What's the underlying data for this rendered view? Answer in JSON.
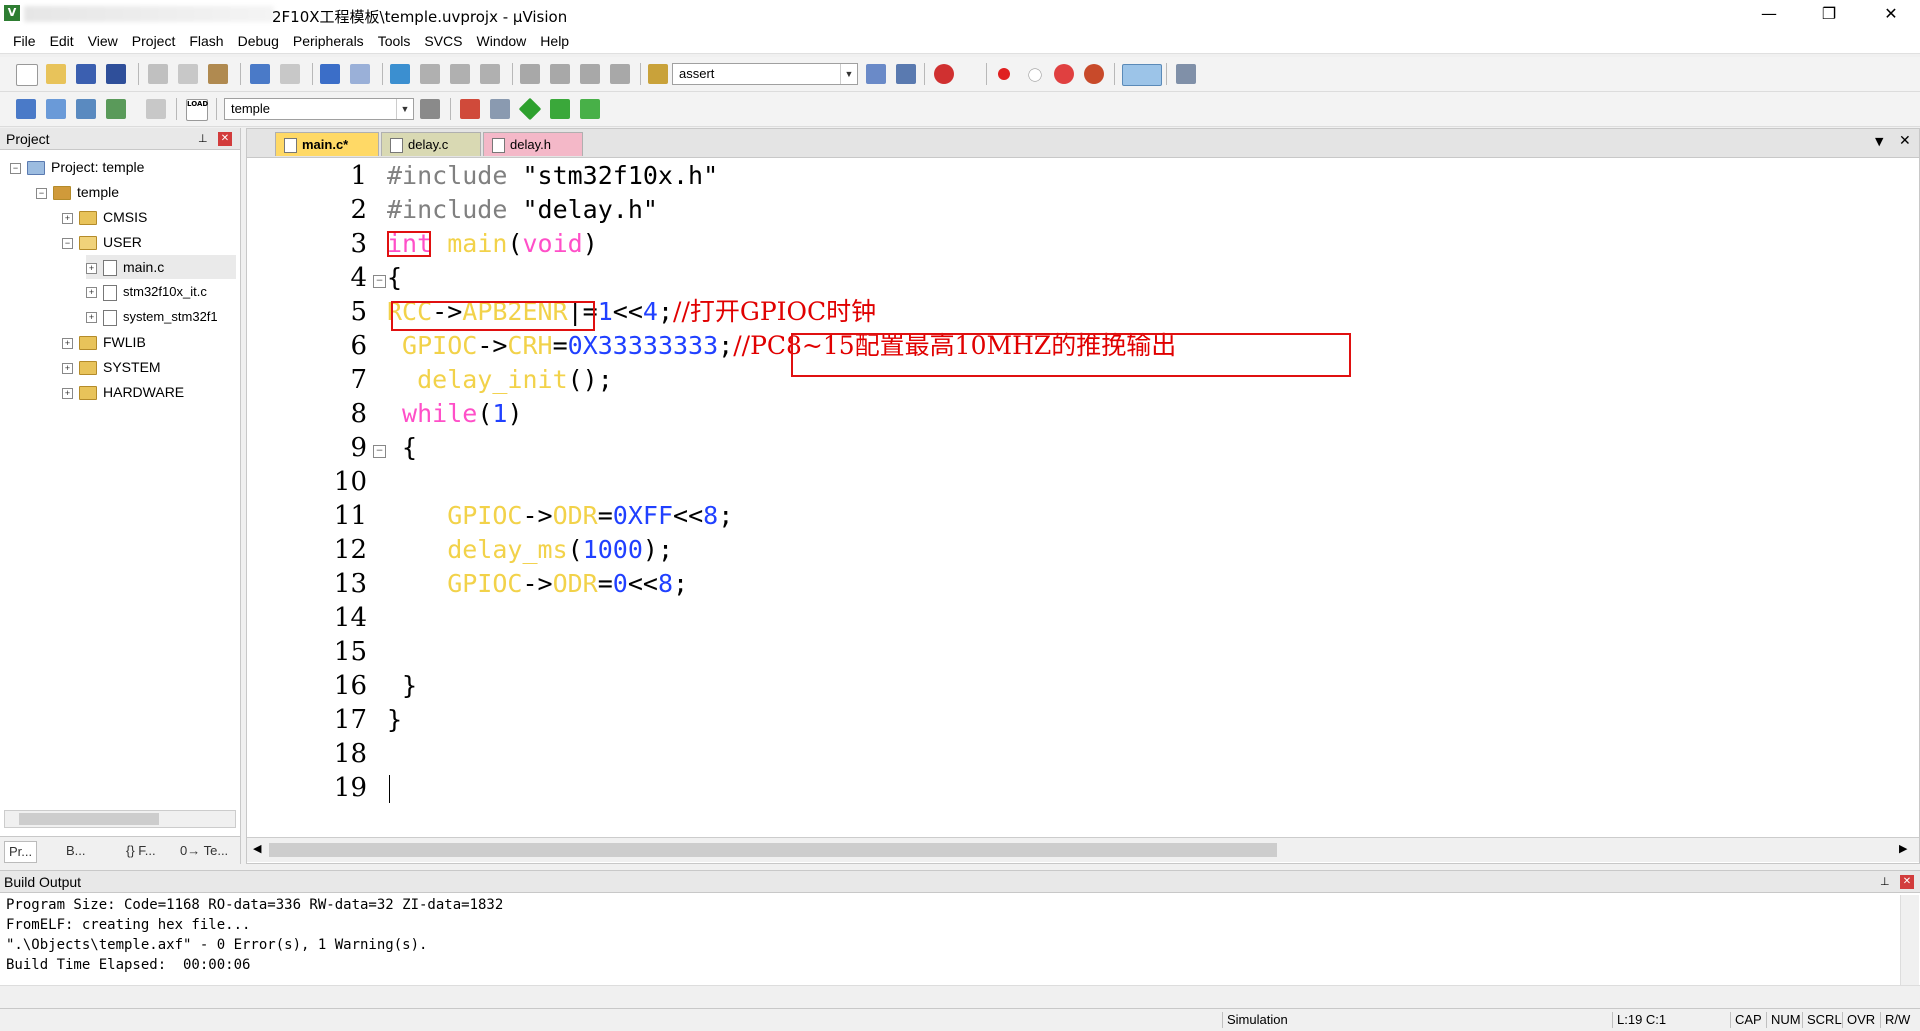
{
  "window": {
    "app_icon": "V",
    "title": "2F10X工程模板\\temple.uvprojx - µVision",
    "minimize": "—",
    "maximize": "❐",
    "close": "✕"
  },
  "menu": [
    "File",
    "Edit",
    "View",
    "Project",
    "Flash",
    "Debug",
    "Peripherals",
    "Tools",
    "SVCS",
    "Window",
    "Help"
  ],
  "toolbar1": {
    "find_combo": "assert"
  },
  "toolbar2": {
    "target_combo": "temple",
    "load_label": "LOAD"
  },
  "project_panel": {
    "title": "Project",
    "pin": "📌",
    "close": "✕",
    "tree": [
      {
        "label": "Project: temple"
      },
      {
        "label": "temple"
      },
      {
        "label": "CMSIS"
      },
      {
        "label": "USER"
      },
      {
        "label": "main.c"
      },
      {
        "label": "stm32f10x_it.c"
      },
      {
        "label": "system_stm32f1"
      },
      {
        "label": "FWLIB"
      },
      {
        "label": "SYSTEM"
      },
      {
        "label": "HARDWARE"
      }
    ],
    "tabs": [
      "Pr...",
      "B...",
      "{} F...",
      "0→ Te..."
    ]
  },
  "editor": {
    "tabs": [
      {
        "label": "main.c*",
        "active": true,
        "color": "#ffd966"
      },
      {
        "label": "delay.c",
        "active": false,
        "color": "#d9d9b3"
      },
      {
        "label": "delay.h",
        "active": false,
        "color": "#f4b8c8"
      }
    ],
    "line_numbers": [
      "1",
      "2",
      "3",
      "4",
      "5",
      "6",
      "7",
      "8",
      "9",
      "10",
      "11",
      "12",
      "13",
      "14",
      "15",
      "16",
      "17",
      "18",
      "19"
    ],
    "lines": {
      "l1_a": "#include ",
      "l1_b": "\"stm32f10x.h\"",
      "l2_a": "#include ",
      "l2_b": "\"delay.h\"",
      "l3_kw": "int",
      "l3_sp": " ",
      "l3_fn": "main",
      "l3_p1": "(",
      "l3_void": "void",
      "l3_p2": ")",
      "l4": "{",
      "l5_a": "RCC",
      "l5_b": "->",
      "l5_c": "APB2ENR",
      "l5_d": "|=",
      "l5_e": "1",
      "l5_f": "<<",
      "l5_g": "4",
      "l5_h": ";",
      "l5_cm": "//打开GPIOC时钟",
      "l6_a": " GPIOC",
      "l6_b": "->",
      "l6_c": "CRH",
      "l6_d": "=",
      "l6_e": "0X33333333",
      "l6_f": ";",
      "l6_cm": "//PC8~15配置最高10MHZ的推挽输出",
      "l7_a": "  delay_init",
      "l7_b": "();",
      "l8_a": " while",
      "l8_b": "(",
      "l8_c": "1",
      "l8_d": ")",
      "l9": " {",
      "l11_a": "    GPIOC",
      "l11_b": "->",
      "l11_c": "ODR",
      "l11_d": "=",
      "l11_e": "0XFF",
      "l11_f": "<<",
      "l11_g": "8",
      "l11_h": ";",
      "l12_a": "    delay_ms",
      "l12_b": "(",
      "l12_c": "1000",
      "l12_d": ");",
      "l13_a": "    GPIOC",
      "l13_b": "->",
      "l13_c": "ODR",
      "l13_d": "=",
      "l13_e": "0",
      "l13_f": "<<",
      "l13_g": "8",
      "l13_h": ";",
      "l16": " }",
      "l17": "}"
    }
  },
  "build_output": {
    "title": "Build Output",
    "lines": [
      "Program Size: Code=1168 RO-data=336 RW-data=32 ZI-data=1832",
      "FromELF: creating hex file...",
      "\".\\Objects\\temple.axf\" - 0 Error(s), 1 Warning(s).",
      "Build Time Elapsed:  00:00:06"
    ]
  },
  "status": {
    "mode": "Simulation",
    "position": "L:19 C:1",
    "cap": "CAP",
    "num": "NUM",
    "scrl": "SCRL",
    "ovr": "OVR",
    "rw": "R/W"
  },
  "colors": {
    "keyword": "#ff4fc8",
    "function": "#f2d24a",
    "number": "#2040ff",
    "comment": "#e00000",
    "annotation": "#e01010",
    "current_line": "#e8fce8"
  }
}
